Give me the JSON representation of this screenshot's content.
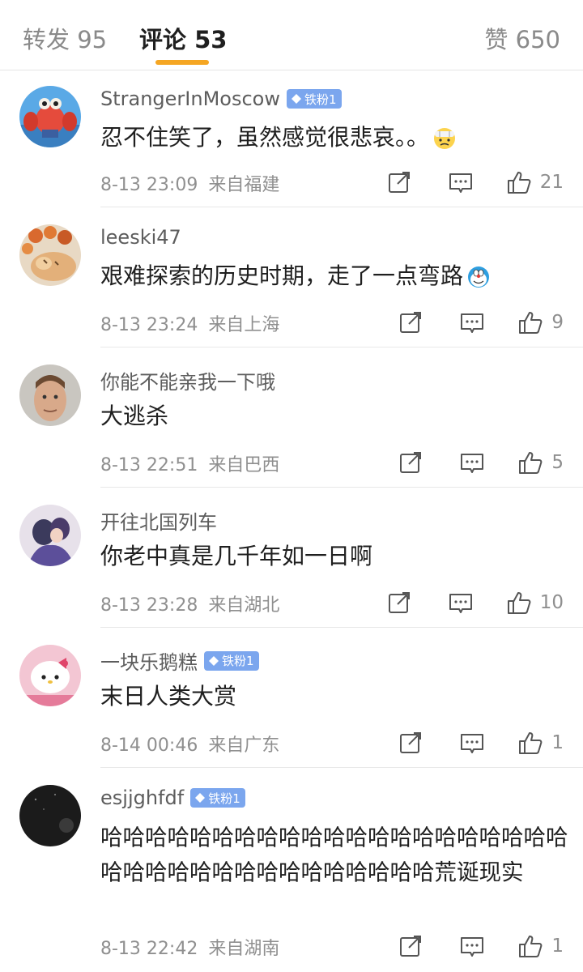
{
  "tabs": {
    "forward_label": "转发 95",
    "comment_label": "评论 53",
    "like_label": "赞 650"
  },
  "comments": [
    {
      "user": "StrangerInMoscow",
      "badge": "铁粉1",
      "text": "忍不住笑了，虽然感觉很悲哀。。",
      "emoji": "face-with-bandage-emoji",
      "time": "8-13 23:09",
      "location": "来自福建",
      "likes": "21"
    },
    {
      "user": "leeski47",
      "badge": "",
      "text": "艰难探索的历史时期，走了一点弯路",
      "emoji": "doraemon-emoji",
      "time": "8-13 23:24",
      "location": "来自上海",
      "likes": "9"
    },
    {
      "user": "你能不能亲我一下哦",
      "badge": "",
      "text": "大逃杀",
      "emoji": "",
      "time": "8-13 22:51",
      "location": "来自巴西",
      "likes": "5"
    },
    {
      "user": "开往北国列车",
      "badge": "",
      "text": "你老中真是几千年如一日啊",
      "emoji": "",
      "time": "8-13 23:28",
      "location": "来自湖北",
      "likes": "10"
    },
    {
      "user": "一块乐鹅糕",
      "badge": "铁粉1",
      "text": "末日人类大赏",
      "emoji": "",
      "time": "8-14 00:46",
      "location": "来自广东",
      "likes": "1"
    },
    {
      "user": "esjjghfdf",
      "badge": "铁粉1",
      "text": "哈哈哈哈哈哈哈哈哈哈哈哈哈哈哈哈哈哈哈哈哈哈哈哈哈哈哈哈哈哈哈哈哈哈哈哈荒诞现实",
      "emoji": "",
      "time": "8-13 22:42",
      "location": "来自湖南",
      "likes": "1"
    }
  ],
  "icons": {
    "share": "share-icon",
    "reply": "comment-icon",
    "like": "thumbs-up-icon",
    "badge": "diamond-icon"
  },
  "colors": {
    "accent": "#f5a623",
    "badge": "#7ba6ee",
    "meta": "#8f8f8f"
  }
}
